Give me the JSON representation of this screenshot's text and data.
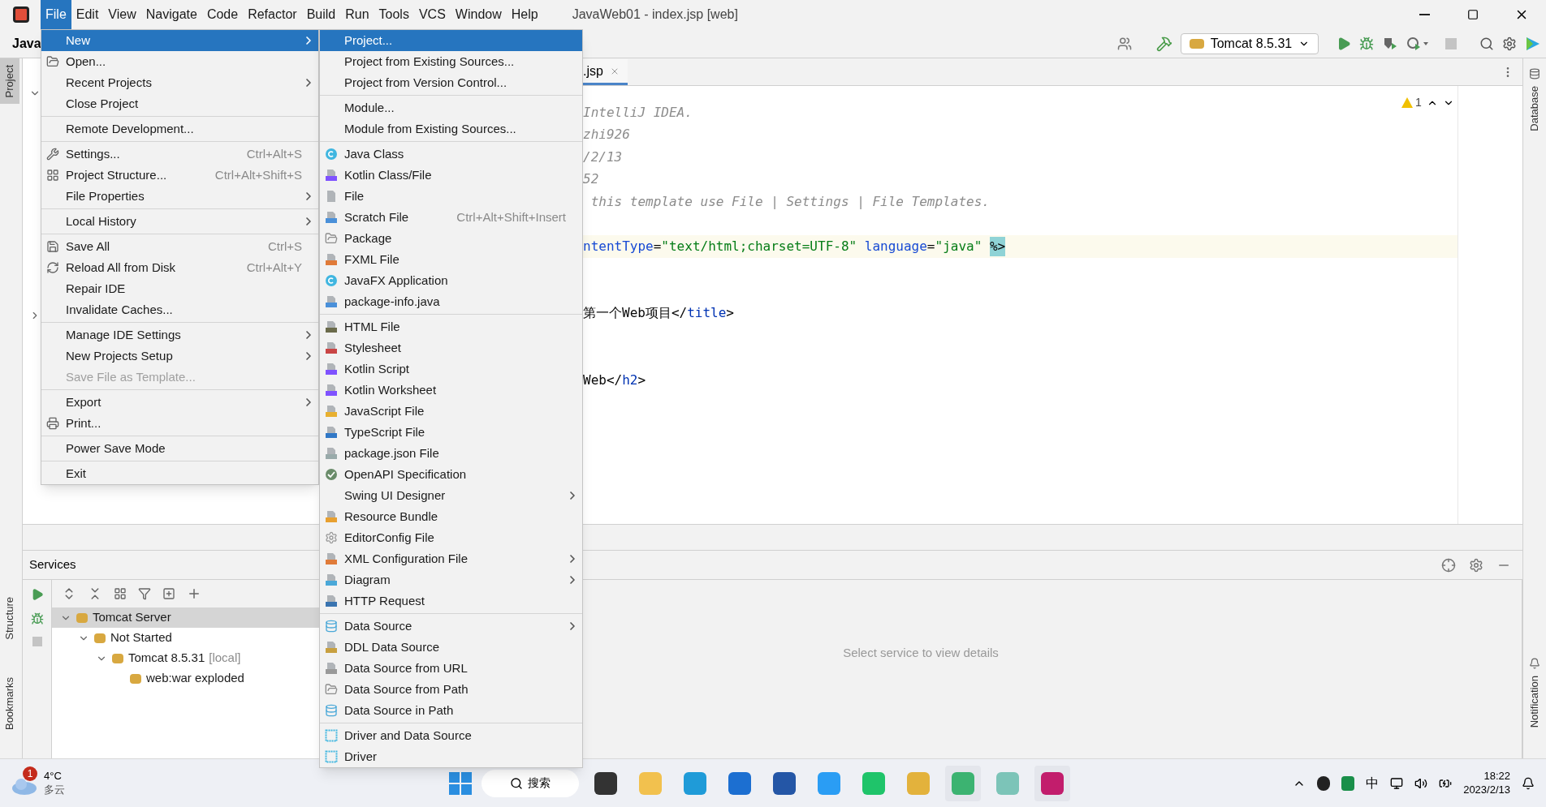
{
  "menu_bar": [
    {
      "label": "File",
      "selected": true
    },
    {
      "label": "Edit",
      "selected": false
    },
    {
      "label": "View",
      "selected": false
    },
    {
      "label": "Navigate",
      "selected": false
    },
    {
      "label": "Code",
      "selected": false
    },
    {
      "label": "Refactor",
      "selected": false
    },
    {
      "label": "Build",
      "selected": false
    },
    {
      "label": "Run",
      "selected": false
    },
    {
      "label": "Tools",
      "selected": false
    },
    {
      "label": "VCS",
      "selected": false
    },
    {
      "label": "Window",
      "selected": false
    },
    {
      "label": "Help",
      "selected": false
    }
  ],
  "window": {
    "title": "JavaWeb01 - index.jsp [web]"
  },
  "project_label": "Java",
  "toolbar": {
    "run_config": "Tomcat 8.5.31"
  },
  "left_stripe": [
    {
      "label": "Project",
      "selected": true
    },
    {
      "label": "Structure",
      "selected": false
    },
    {
      "label": "Bookmarks",
      "selected": false
    }
  ],
  "right_stripe": [
    {
      "label": "Database",
      "selected": false
    },
    {
      "label": "Notification",
      "selected": false
    }
  ],
  "editor": {
    "tab": ".jsp",
    "warnings": "1",
    "lines": [
      {
        "kind": "code",
        "current": false,
        "tokens": [
          {
            "kind": "comment",
            "text": "IntelliJ IDEA."
          }
        ]
      },
      {
        "kind": "code",
        "current": false,
        "tokens": [
          {
            "kind": "comment",
            "text": "zhi926"
          }
        ]
      },
      {
        "kind": "code",
        "current": false,
        "tokens": [
          {
            "kind": "comment",
            "text": "/2/13"
          }
        ]
      },
      {
        "kind": "code",
        "current": false,
        "tokens": [
          {
            "kind": "comment",
            "text": "52"
          }
        ]
      },
      {
        "kind": "code",
        "current": false,
        "tokens": [
          {
            "kind": "comment",
            "text": " this template use File | Settings | File Templates."
          }
        ]
      },
      {
        "kind": "blank"
      },
      {
        "kind": "code",
        "current": true,
        "tokens": [
          {
            "kind": "attr",
            "text": "ntentType"
          },
          {
            "kind": "plain",
            "text": "="
          },
          {
            "kind": "string",
            "text": "\"text/html;charset=UTF-8\" "
          },
          {
            "kind": "attr",
            "text": "language"
          },
          {
            "kind": "plain",
            "text": "="
          },
          {
            "kind": "string",
            "text": "\"java\" "
          },
          {
            "kind": "mark",
            "text": "%>"
          }
        ]
      },
      {
        "kind": "blank"
      },
      {
        "kind": "blank"
      },
      {
        "kind": "code",
        "current": false,
        "tokens": [
          {
            "kind": "plain",
            "text": "第一个Web项目</"
          },
          {
            "kind": "tag",
            "text": "title"
          },
          {
            "kind": "plain",
            "text": ">"
          }
        ]
      },
      {
        "kind": "blank"
      },
      {
        "kind": "blank"
      },
      {
        "kind": "code",
        "current": false,
        "tokens": [
          {
            "kind": "plain",
            "text": "Web</"
          },
          {
            "kind": "tag",
            "text": "h2"
          },
          {
            "kind": "plain",
            "text": ">"
          }
        ]
      }
    ]
  },
  "services": {
    "title": "Services",
    "empty_text": "Select service to view details",
    "tree": [
      {
        "label": "Tomcat Server",
        "selected": true,
        "expanded": true,
        "children": [
          {
            "label": "Not Started",
            "selected": false,
            "expanded": true,
            "children": [
              {
                "label": "Tomcat 8.5.31",
                "suffix": "[local]",
                "selected": false,
                "expanded": true,
                "children": [
                  {
                    "label": "web:war exploded",
                    "selected": false,
                    "expanded": false
                  }
                ]
              }
            ]
          }
        ]
      }
    ]
  },
  "file_menu": [
    {
      "kind": "submenu",
      "label": "New",
      "selected": true,
      "disabled": false
    },
    {
      "kind": "item",
      "label": "Open...",
      "selected": false,
      "disabled": false
    },
    {
      "kind": "submenu",
      "label": "Recent Projects",
      "selected": false,
      "disabled": false
    },
    {
      "kind": "item",
      "label": "Close Project",
      "selected": false,
      "disabled": false
    },
    {
      "kind": "separator"
    },
    {
      "kind": "item",
      "label": "Remote Development...",
      "selected": false,
      "disabled": false
    },
    {
      "kind": "separator"
    },
    {
      "kind": "item",
      "label": "Settings...",
      "shortcut": "Ctrl+Alt+S",
      "selected": false,
      "disabled": false
    },
    {
      "kind": "item",
      "label": "Project Structure...",
      "shortcut": "Ctrl+Alt+Shift+S",
      "selected": false,
      "disabled": false
    },
    {
      "kind": "submenu",
      "label": "File Properties",
      "selected": false,
      "disabled": false
    },
    {
      "kind": "separator"
    },
    {
      "kind": "submenu",
      "label": "Local History",
      "selected": false,
      "disabled": false
    },
    {
      "kind": "separator"
    },
    {
      "kind": "item",
      "label": "Save All",
      "shortcut": "Ctrl+S",
      "selected": false,
      "disabled": false
    },
    {
      "kind": "item",
      "label": "Reload All from Disk",
      "shortcut": "Ctrl+Alt+Y",
      "selected": false,
      "disabled": false
    },
    {
      "kind": "item",
      "label": "Repair IDE",
      "selected": false,
      "disabled": false
    },
    {
      "kind": "item",
      "label": "Invalidate Caches...",
      "selected": false,
      "disabled": false
    },
    {
      "kind": "separator"
    },
    {
      "kind": "submenu",
      "label": "Manage IDE Settings",
      "selected": false,
      "disabled": false
    },
    {
      "kind": "submenu",
      "label": "New Projects Setup",
      "selected": false,
      "disabled": false
    },
    {
      "kind": "item",
      "label": "Save File as Template...",
      "selected": false,
      "disabled": true
    },
    {
      "kind": "separator"
    },
    {
      "kind": "submenu",
      "label": "Export",
      "selected": false,
      "disabled": false
    },
    {
      "kind": "item",
      "label": "Print...",
      "selected": false,
      "disabled": false
    },
    {
      "kind": "separator"
    },
    {
      "kind": "item",
      "label": "Power Save Mode",
      "selected": false,
      "disabled": false
    },
    {
      "kind": "separator"
    },
    {
      "kind": "item",
      "label": "Exit",
      "selected": false,
      "disabled": false
    }
  ],
  "new_menu": [
    {
      "kind": "item",
      "label": "Project...",
      "selected": true
    },
    {
      "kind": "item",
      "label": "Project from Existing Sources...",
      "selected": false
    },
    {
      "kind": "item",
      "label": "Project from Version Control...",
      "selected": false
    },
    {
      "kind": "separator"
    },
    {
      "kind": "item",
      "label": "Module...",
      "selected": false
    },
    {
      "kind": "item",
      "label": "Module from Existing Sources...",
      "selected": false
    },
    {
      "kind": "separator"
    },
    {
      "kind": "item",
      "label": "Java Class",
      "selected": false
    },
    {
      "kind": "item",
      "label": "Kotlin Class/File",
      "selected": false
    },
    {
      "kind": "item",
      "label": "File",
      "selected": false
    },
    {
      "kind": "item",
      "label": "Scratch File",
      "shortcut": "Ctrl+Alt+Shift+Insert",
      "selected": false
    },
    {
      "kind": "item",
      "label": "Package",
      "selected": false
    },
    {
      "kind": "item",
      "label": "FXML File",
      "selected": false
    },
    {
      "kind": "item",
      "label": "JavaFX Application",
      "selected": false
    },
    {
      "kind": "item",
      "label": "package-info.java",
      "selected": false
    },
    {
      "kind": "separator"
    },
    {
      "kind": "item",
      "label": "HTML File",
      "selected": false
    },
    {
      "kind": "item",
      "label": "Stylesheet",
      "selected": false
    },
    {
      "kind": "item",
      "label": "Kotlin Script",
      "selected": false
    },
    {
      "kind": "item",
      "label": "Kotlin Worksheet",
      "selected": false
    },
    {
      "kind": "item",
      "label": "JavaScript File",
      "selected": false
    },
    {
      "kind": "item",
      "label": "TypeScript File",
      "selected": false
    },
    {
      "kind": "item",
      "label": "package.json File",
      "selected": false
    },
    {
      "kind": "item",
      "label": "OpenAPI Specification",
      "selected": false
    },
    {
      "kind": "submenu",
      "label": "Swing UI Designer",
      "selected": false
    },
    {
      "kind": "item",
      "label": "Resource Bundle",
      "selected": false
    },
    {
      "kind": "item",
      "label": "EditorConfig File",
      "selected": false
    },
    {
      "kind": "submenu",
      "label": "XML Configuration File",
      "selected": false
    },
    {
      "kind": "submenu",
      "label": "Diagram",
      "selected": false
    },
    {
      "kind": "item",
      "label": "HTTP Request",
      "selected": false
    },
    {
      "kind": "separator"
    },
    {
      "kind": "submenu",
      "label": "Data Source",
      "selected": false
    },
    {
      "kind": "item",
      "label": "DDL Data Source",
      "selected": false
    },
    {
      "kind": "item",
      "label": "Data Source from URL",
      "selected": false
    },
    {
      "kind": "item",
      "label": "Data Source from Path",
      "selected": false
    },
    {
      "kind": "item",
      "label": "Data Source in Path",
      "selected": false
    },
    {
      "kind": "separator"
    },
    {
      "kind": "item",
      "label": "Driver and Data Source",
      "selected": false
    },
    {
      "kind": "item",
      "label": "Driver",
      "selected": false
    }
  ],
  "taskbar": {
    "weather_badge": "1",
    "temperature": "4°C",
    "condition": "多云",
    "search": "搜索",
    "ime": "中",
    "time": "18:22",
    "date": "2023/2/13"
  }
}
